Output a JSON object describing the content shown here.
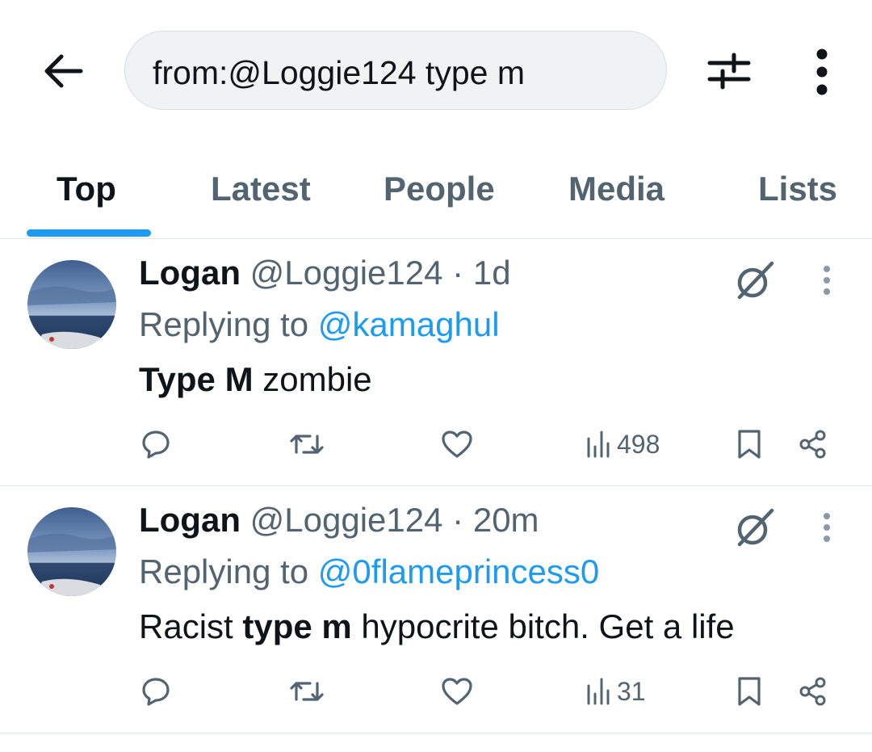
{
  "search": {
    "query": "from:@Loggie124 type m"
  },
  "tabs": [
    {
      "label": "Top",
      "active": true
    },
    {
      "label": "Latest",
      "active": false
    },
    {
      "label": "People",
      "active": false
    },
    {
      "label": "Media",
      "active": false
    },
    {
      "label": "Lists",
      "active": false
    }
  ],
  "colors": {
    "accent": "#1d9bf0",
    "muted": "#536471",
    "text": "#0f1419"
  },
  "tweets": [
    {
      "name": "Logan",
      "handle": "@Loggie124",
      "separator": "·",
      "time": "1d",
      "replying_prefix": "Replying to",
      "replying_to": "@kamaghul",
      "body_bold": "Type M",
      "body_after": " zombie",
      "body_before": "",
      "views": "498"
    },
    {
      "name": "Logan",
      "handle": "@Loggie124",
      "separator": "·",
      "time": "20m",
      "replying_prefix": "Replying to",
      "replying_to": "@0flameprincess0",
      "body_before": "Racist ",
      "body_bold": "type m",
      "body_after": " hypocrite bitch. Get a life",
      "views": "31"
    }
  ],
  "icons": {
    "back": "arrow-left-icon",
    "filter": "sliders-icon",
    "more": "more-vertical-icon",
    "grok": "grok-slash-circle-icon",
    "reply": "reply-bubble-icon",
    "retweet": "retweet-icon",
    "like": "heart-icon",
    "views": "views-bar-icon",
    "bookmark": "bookmark-icon",
    "share": "share-icon"
  }
}
